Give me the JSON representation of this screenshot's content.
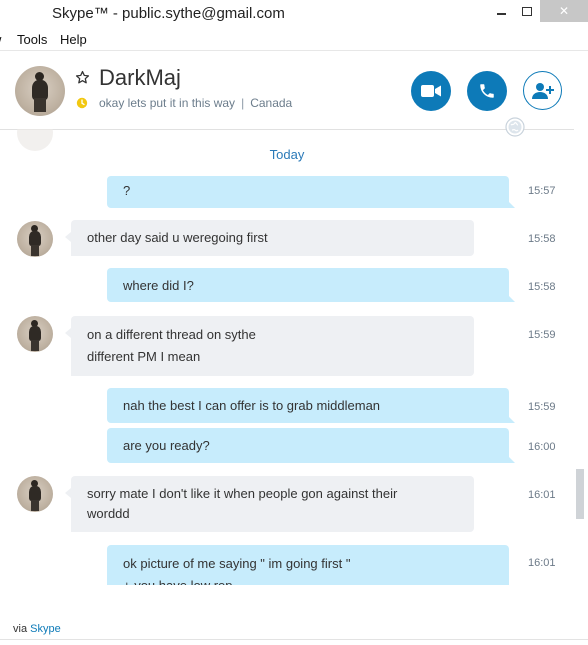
{
  "window": {
    "title": "Skype™ - public.sythe@gmail.com",
    "close_glyph": "✕"
  },
  "menu": {
    "cut_item": "w",
    "tools": "Tools",
    "help": "Help"
  },
  "contact": {
    "name": "DarkMaj",
    "mood": "okay lets put it in this way",
    "separator": "|",
    "location": "Canada"
  },
  "colors": {
    "accent": "#0d7ab8",
    "outgoing_bubble": "#c7ecfc",
    "incoming_bubble": "#eef0f3",
    "mood_status": "#f2c811"
  },
  "conversation": {
    "day_label": "Today",
    "messages": [
      {
        "dir": "out",
        "lines": [
          "?"
        ],
        "time": "15:57"
      },
      {
        "dir": "in",
        "lines": [
          "other day said u weregoing first"
        ],
        "time": "15:58"
      },
      {
        "dir": "out",
        "lines": [
          "where did I?"
        ],
        "time": "15:58"
      },
      {
        "dir": "in",
        "lines": [
          "on a different thread on sythe",
          "different PM I mean"
        ],
        "time": "15:59"
      },
      {
        "dir": "out",
        "lines": [
          "nah the best I can offer is to grab middleman"
        ],
        "time": "15:59"
      },
      {
        "dir": "out",
        "lines": [
          "are you ready?"
        ],
        "time": "16:00"
      },
      {
        "dir": "in",
        "lines": [
          "sorry mate I don't like it when people gon against their",
          "worddd"
        ],
        "time": "16:01"
      },
      {
        "dir": "out",
        "lines": [
          "ok picture of me saying \" im going first \"",
          "+ you have low rep"
        ],
        "time": "16:01"
      }
    ]
  },
  "footer": {
    "via_prefix": "via",
    "via_link": "Skype"
  },
  "icons": [
    "star-icon",
    "mood-status-icon",
    "video-call-icon",
    "phone-icon",
    "add-contact-icon",
    "globe-icon",
    "minimize-icon",
    "maximize-icon",
    "close-icon"
  ]
}
